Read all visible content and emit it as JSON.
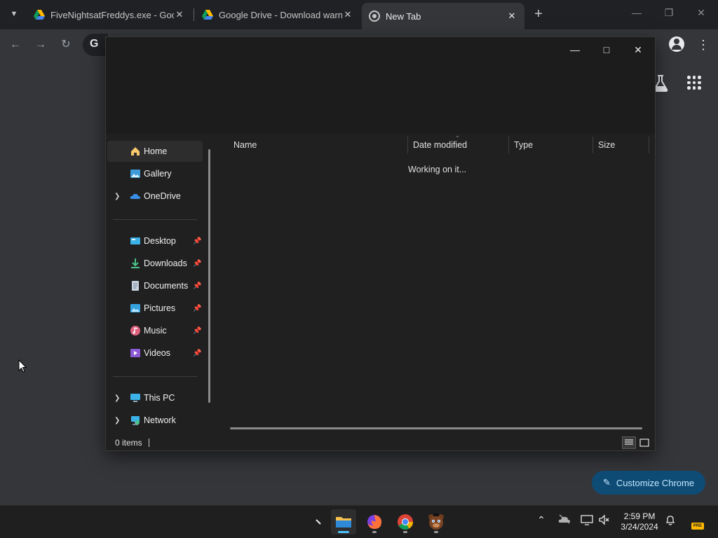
{
  "chrome": {
    "tabs": [
      {
        "title": "FiveNightsatFreddys.exe - Google Drive"
      },
      {
        "title": "Google Drive - Download warning"
      },
      {
        "title": "New Tab"
      }
    ],
    "omnibox_letter": "G",
    "customize_label": "Customize Chrome"
  },
  "explorer": {
    "nav": {
      "home": "Home",
      "gallery": "Gallery",
      "onedrive": "OneDrive",
      "desktop": "Desktop",
      "downloads": "Downloads",
      "documents": "Documents",
      "pictures": "Pictures",
      "music": "Music",
      "videos": "Videos",
      "thispc": "This PC",
      "network": "Network"
    },
    "columns": {
      "name": "Name",
      "date_modified": "Date modified",
      "type": "Type",
      "size": "Size"
    },
    "status_message": "Working on it...",
    "items_count": "0 items"
  },
  "taskbar": {
    "time": "2:59 PM",
    "date": "3/24/2024",
    "badge": "PRE"
  },
  "colors": {
    "accent_blue": "#4cc2ff",
    "customize_bg": "#0f4c75",
    "explorer_bg": "#202020"
  }
}
